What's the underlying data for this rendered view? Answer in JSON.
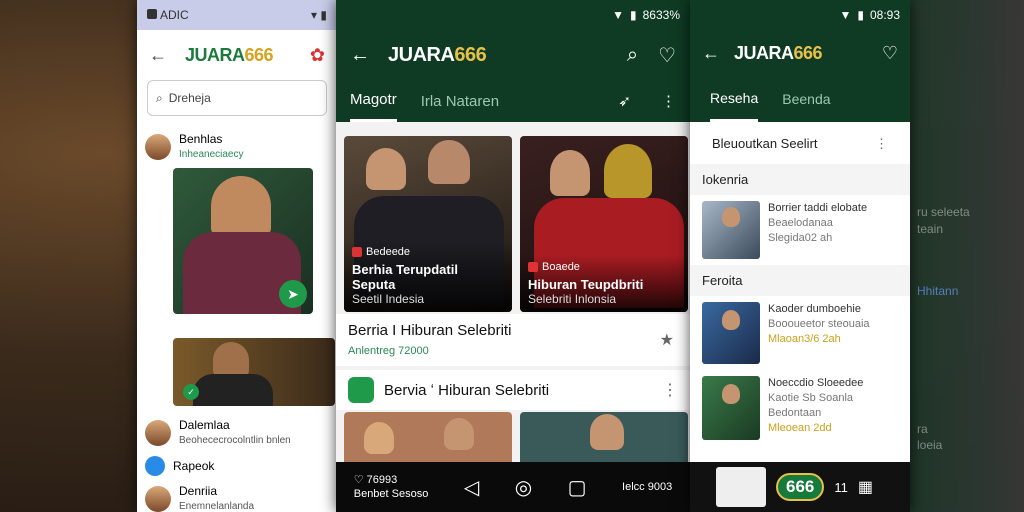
{
  "background_right": {
    "labels": [
      "ru seleeta",
      "teain",
      "ra",
      "loeia",
      "Hhitann"
    ]
  },
  "phone1": {
    "status_left": "ADIC",
    "logo_a": "JUARA",
    "logo_b": "666",
    "search_value": "Dreheja",
    "contacts": [
      {
        "name": "Benhlas",
        "sub": "Inheaneciaecy"
      },
      {
        "name": "Dalemlaa",
        "sub": "Beohececrocolntlin bnlen"
      },
      {
        "name": "Rapeok",
        "sub": ""
      },
      {
        "name": "Denriia",
        "sub": "Enemnelanlanda"
      }
    ]
  },
  "phone2": {
    "status_time": "8633%",
    "logo_a": "JUARA",
    "logo_b": "666",
    "tabs": [
      "Magotr",
      "Irla Nataren"
    ],
    "cards": [
      {
        "source": "Bedeede",
        "title": "Berhia Terupdatil Seputa",
        "sub": "Seetil Indesia"
      },
      {
        "source": "Boaede",
        "title": "Hiburan Teupdbriti",
        "sub": "Selebriti Inlonsia"
      }
    ],
    "headline": "Berria I Hiburan Selebriti",
    "headline_meta": "Anlentreg 72000",
    "section2": "Bervia ʻ Hiburan Selebriti",
    "bottom_count": "76993",
    "bottom_label": "Benbet Sesoso",
    "bottom_label2": "Ielcc 9003"
  },
  "phone3": {
    "status_time": "08:93",
    "logo_a": "JUARA",
    "logo_b": "666",
    "tabs": [
      "Reseha",
      "Beenda"
    ],
    "header": "Bleuoutkan Seelirt",
    "section1": "Iokenria",
    "item1": {
      "title": "Borrier taddi elobate",
      "meta": "Beaelodanaa",
      "time": "Slegida02 ah"
    },
    "section2": "Feroita",
    "item2": {
      "title": "Kaoder dumboehie",
      "meta": "Boooueetor steouaia",
      "time": "Mlaoan3/6 2ah"
    },
    "item3": {
      "title": "Noeccdio Sloeedee",
      "meta": "Kaotie Sb Soanla",
      "meta2": "Bedontaan",
      "time": "Mleoean 2dd"
    },
    "dock_count": "11",
    "badge": "666"
  },
  "colors": {
    "brand_green": "#0f3a24",
    "accent_gold": "#e7c04a",
    "fab_green": "#1f9a4a"
  }
}
